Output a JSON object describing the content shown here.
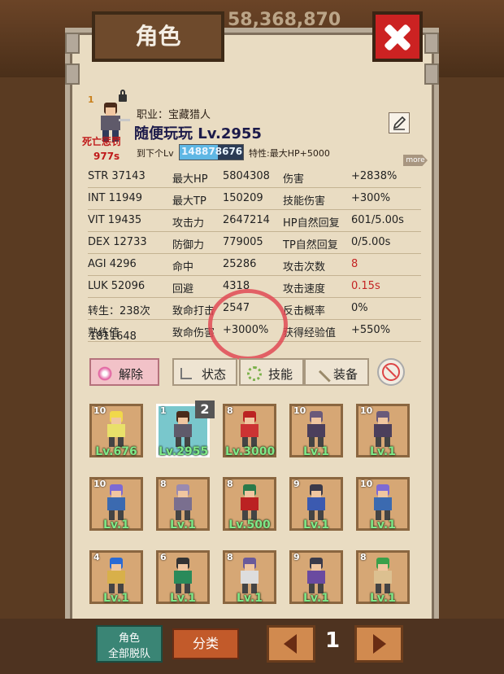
{
  "header": {
    "gold": "58,368,870",
    "title": "角色"
  },
  "character": {
    "job": "职业：宝藏猎人",
    "name": "随便玩玩 Lv.2955",
    "rank": "1",
    "death_label": "死亡惩罚",
    "death_time": "977s",
    "next_label": "到下个Lv",
    "exp": "148878676",
    "trait": "特性:最大HP+5000",
    "more": "more"
  },
  "stats": [
    {
      "a": "STR 37143",
      "b": "最大HP",
      "c": "5804308",
      "d": "伤害",
      "e": "+2838%"
    },
    {
      "a": "INT 11949",
      "b": "最大TP",
      "c": "150209",
      "d": "技能伤害",
      "e": "+300%"
    },
    {
      "a": "VIT 19435",
      "b": "攻击力",
      "c": "2647214",
      "d": "HP自然回复",
      "e": "601/5.00s"
    },
    {
      "a": "DEX 12733",
      "b": "防御力",
      "c": "779005",
      "d": "TP自然回复",
      "e": "0/5.00s"
    },
    {
      "a": "AGI 4296",
      "b": "命中",
      "c": "25286",
      "d": "攻击次数",
      "e": "8"
    },
    {
      "a": "LUK 52096",
      "b": "回避",
      "c": "4318",
      "d": "攻击速度",
      "e": "0.15s"
    },
    {
      "a": "转生：238次",
      "b": "致命打击",
      "c": "2547",
      "d": "反击概率",
      "e": "0%"
    },
    {
      "a": "熟练值",
      "b": "致命伤害",
      "c": "+3000%",
      "d": "获得经验值",
      "e": "+550%"
    }
  ],
  "proficiency_value": "1811648",
  "tabs": {
    "release": "解除",
    "status": "状态",
    "skill": "技能",
    "equip": "装备"
  },
  "grid": [
    {
      "num": "10",
      "lv": "Lv.676"
    },
    {
      "num": "1",
      "lv": "Lv.2955"
    },
    {
      "num": "8",
      "lv": "Lv.3000"
    },
    {
      "num": "10",
      "lv": "Lv.1"
    },
    {
      "num": "10",
      "lv": "Lv.1"
    },
    {
      "num": "10",
      "lv": "Lv.1"
    },
    {
      "num": "8",
      "lv": "Lv.1"
    },
    {
      "num": "8",
      "lv": "Lv.500"
    },
    {
      "num": "9",
      "lv": "Lv.1"
    },
    {
      "num": "10",
      "lv": "Lv.1"
    },
    {
      "num": "4",
      "lv": "Lv.1"
    },
    {
      "num": "6",
      "lv": "Lv.1"
    },
    {
      "num": "8",
      "lv": "Lv.1"
    },
    {
      "num": "9",
      "lv": "Lv.1"
    },
    {
      "num": "8",
      "lv": "Lv.1"
    }
  ],
  "party_badge": "2",
  "footer": {
    "party_line1": "角色",
    "party_line2": "全部脱队",
    "sort": "分类",
    "page": "1"
  },
  "colors": {
    "selected_slot": "#79c7cc",
    "level_text": "#7fe888",
    "warning_red": "#c42424"
  }
}
